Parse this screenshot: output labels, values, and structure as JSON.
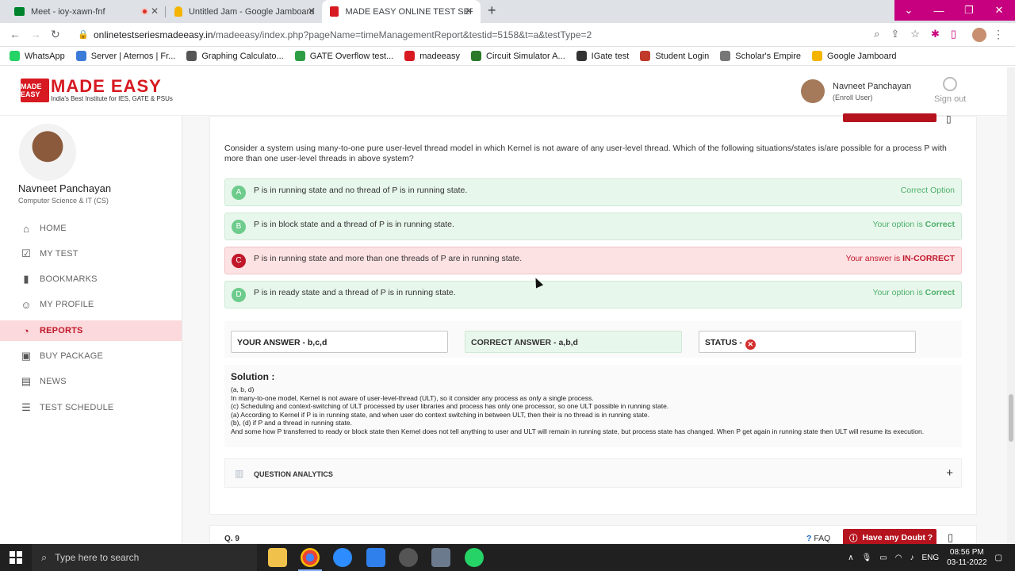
{
  "browser": {
    "tabs": [
      {
        "title": "Meet - ioy-xawn-fnf"
      },
      {
        "title": "Untitled Jam - Google Jamboard"
      },
      {
        "title": "MADE EASY ONLINE TEST SERIES"
      }
    ],
    "url_host": "onlinetestseriesmadeeasy.in",
    "url_path": "/madeeasy/index.php?pageName=timeManagementReport&testid=5158&t=a&testType=2",
    "bookmarks": [
      {
        "label": "WhatsApp",
        "color": "#25d366"
      },
      {
        "label": "Server | Aternos | Fr...",
        "color": "#3b7bd8"
      },
      {
        "label": "Graphing Calculato...",
        "color": "#555555"
      },
      {
        "label": "GATE Overflow test...",
        "color": "#2e9e45"
      },
      {
        "label": "madeeasy",
        "color": "#d71921"
      },
      {
        "label": "Circuit Simulator A...",
        "color": "#2a7a2a"
      },
      {
        "label": "IGate test",
        "color": "#333333"
      },
      {
        "label": "Student Login",
        "color": "#c0392b"
      },
      {
        "label": "Scholar's Empire",
        "color": "#777777"
      },
      {
        "label": "Google Jamboard",
        "color": "#f4b400"
      }
    ]
  },
  "header": {
    "logo_mark": "MADE EASY",
    "logo_name": "MADE EASY",
    "logo_tagline": "India's Best Institute for IES, GATE & PSUs",
    "user_name": "Navneet Panchayan",
    "user_role": "(Enroll User)",
    "signout_label": "Sign out"
  },
  "sidebar": {
    "name": "Navneet Panchayan",
    "branch": "Computer Science & IT (CS)",
    "items": [
      {
        "label": "HOME",
        "icon": "home-icon"
      },
      {
        "label": "MY TEST",
        "icon": "test-icon"
      },
      {
        "label": "BOOKMARKS",
        "icon": "bookmark-icon"
      },
      {
        "label": "MY PROFILE",
        "icon": "user-icon"
      },
      {
        "label": "REPORTS",
        "icon": "pie-chart-icon"
      },
      {
        "label": "BUY PACKAGE",
        "icon": "package-icon"
      },
      {
        "label": "NEWS",
        "icon": "news-icon"
      },
      {
        "label": "TEST SCHEDULE",
        "icon": "schedule-icon"
      }
    ]
  },
  "question": {
    "text": "Consider a system using many-to-one pure user-level thread model in which Kernel is not aware of any user-level thread. Which of the following situations/states is/are possible for a process P with more than one user-level threads in above system?",
    "options": [
      {
        "letter": "A",
        "text": "P is in running state and no thread of P is in running state.",
        "status_prefix": "Correct Option",
        "status_strong": ""
      },
      {
        "letter": "B",
        "text": "P is in block state and a thread of P is in running state.",
        "status_prefix": "Your option is ",
        "status_strong": "Correct"
      },
      {
        "letter": "C",
        "text": "P is in running state and more than one threads of P are in running state.",
        "status_prefix": "Your answer is ",
        "status_strong": "IN-CORRECT"
      },
      {
        "letter": "D",
        "text": "P is in ready state and a thread of P is in running state.",
        "status_prefix": "Your option is ",
        "status_strong": "Correct"
      }
    ],
    "your_answer": "YOUR ANSWER - b,c,d",
    "correct_answer": "CORRECT ANSWER - a,b,d",
    "status_label": "STATUS -",
    "status_mark": "✕"
  },
  "solution": {
    "title": "Solution :",
    "lines": [
      "(a, b, d)",
      "In many-to-one model, Kernel is not aware of user-level-thread (ULT), so it consider any process as only a single process.",
      "(c) Scheduling and context-switching of ULT processed by user libraries and process has only one processor, so one ULT possible in running state.",
      "(a) According to Kernel if P is in running state, and when user do context switching in between ULT, then their is no thread is in running state.",
      "(b), (d) if P and a thread in running state.",
      "And some how P transferred to ready or block state then Kernel does not tell anything to user and ULT will remain in running state, but process state has changed. When P get again in running state then ULT will resume its execution."
    ]
  },
  "analytics": {
    "label": "QUESTION ANALYTICS",
    "toggle": "+"
  },
  "next_question": {
    "label": "Q. 9",
    "faq": "FAQ",
    "doubt": "Have any Doubt ?"
  },
  "taskbar": {
    "search_placeholder": "Type here to search",
    "language": "ENG",
    "time": "08:56 PM",
    "date": "03-11-2022"
  }
}
